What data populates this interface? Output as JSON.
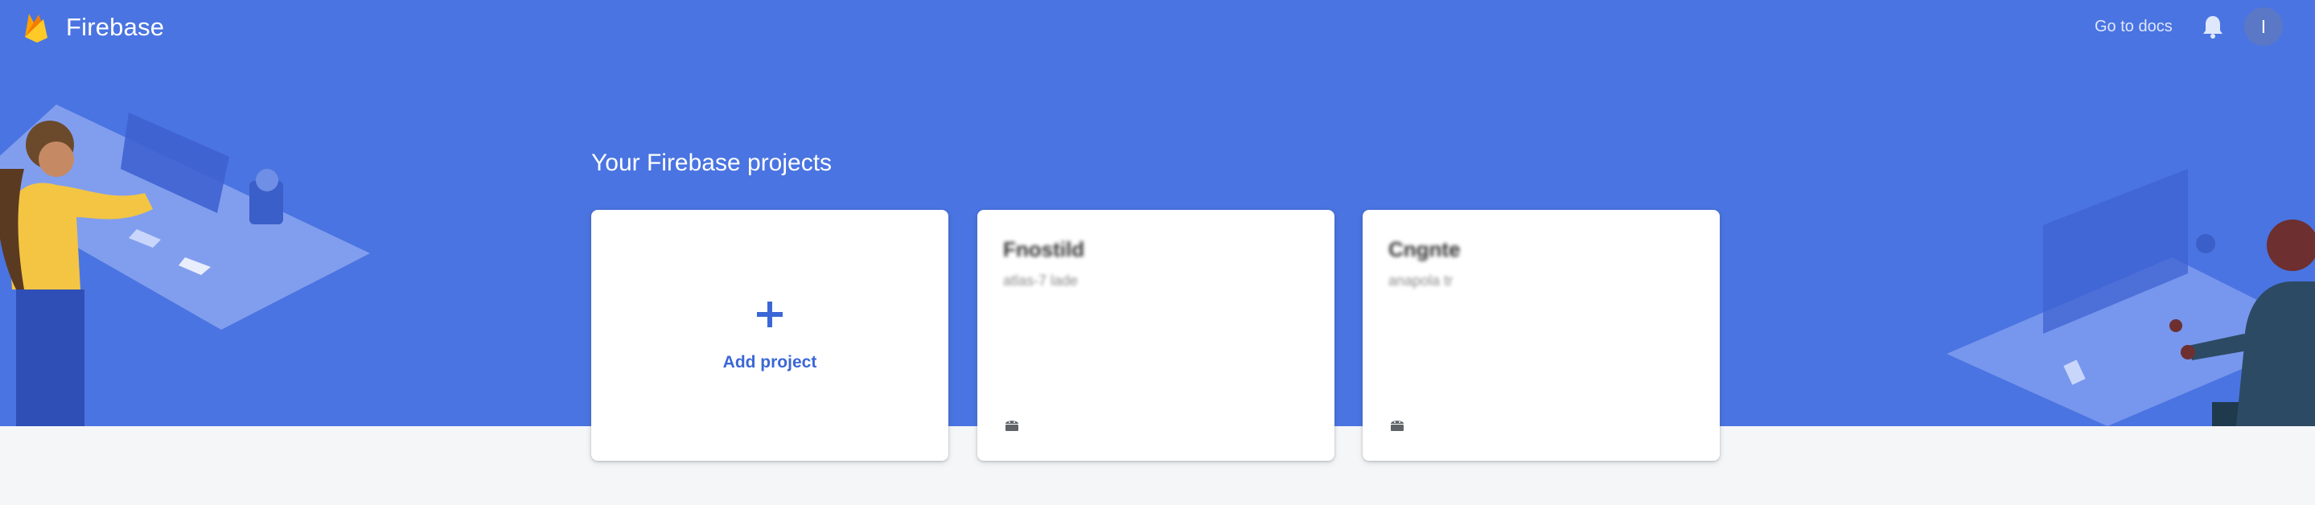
{
  "header": {
    "app_name": "Firebase",
    "docs_link": "Go to docs",
    "avatar_letter": "I"
  },
  "main": {
    "section_title": "Your Firebase projects",
    "add_card": {
      "label": "Add project"
    },
    "projects": [
      {
        "name": "Fnostild",
        "project_id": "atlas-7 lade"
      },
      {
        "name": "Cngnte",
        "project_id": "anapola tr"
      }
    ]
  },
  "colors": {
    "hero_blue": "#4a74e1",
    "link_blue": "#3b67d6",
    "firebase_yellow": "#ffca28",
    "firebase_orange": "#ffa000"
  },
  "icons": [
    "firebase-logo-icon",
    "bell-icon",
    "plus-icon",
    "android-icon"
  ]
}
